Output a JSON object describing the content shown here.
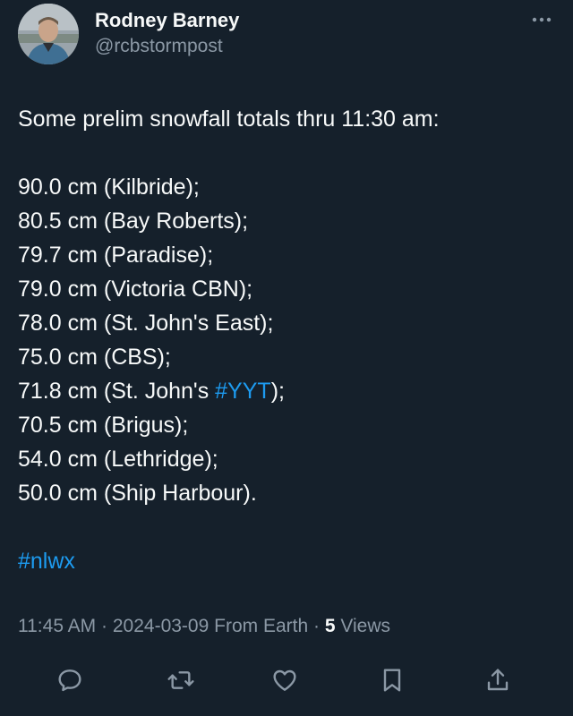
{
  "author": {
    "name": "Rodney Barney",
    "handle": "@rcbstormpost",
    "avatar_icon": "profile-photo"
  },
  "tweet": {
    "intro": "Some prelim snowfall totals thru 11:30 am:",
    "totals": [
      {
        "text": "90.0 cm (Kilbride);"
      },
      {
        "text": "80.5 cm (Bay Roberts);"
      },
      {
        "text": "79.7 cm (Paradise);"
      },
      {
        "text": "79.0 cm (Victoria CBN);"
      },
      {
        "text": "78.0 cm (St. John's East);"
      },
      {
        "text": "75.0 cm (CBS);"
      },
      {
        "before": "71.8 cm (St. John's ",
        "hashtag": "#YYT",
        "after": ");"
      },
      {
        "text": "70.5 cm (Brigus);"
      },
      {
        "text": "54.0 cm (Lethridge);"
      },
      {
        "text": "50.0 cm (Ship Harbour)."
      }
    ],
    "hashtag_footer": "#nlwx"
  },
  "meta": {
    "time": "11:45 AM",
    "separator": "·",
    "date": "2024-03-09",
    "source": "From Earth",
    "views_count": "5",
    "views_label": "Views"
  },
  "actions": [
    {
      "icon": "reply-icon"
    },
    {
      "icon": "retweet-icon"
    },
    {
      "icon": "like-icon"
    },
    {
      "icon": "bookmark-icon"
    },
    {
      "icon": "share-icon"
    }
  ],
  "colors": {
    "background": "#15202b",
    "text": "#f7f9f9",
    "secondary": "#8b98a5",
    "link": "#1d9bf0"
  }
}
